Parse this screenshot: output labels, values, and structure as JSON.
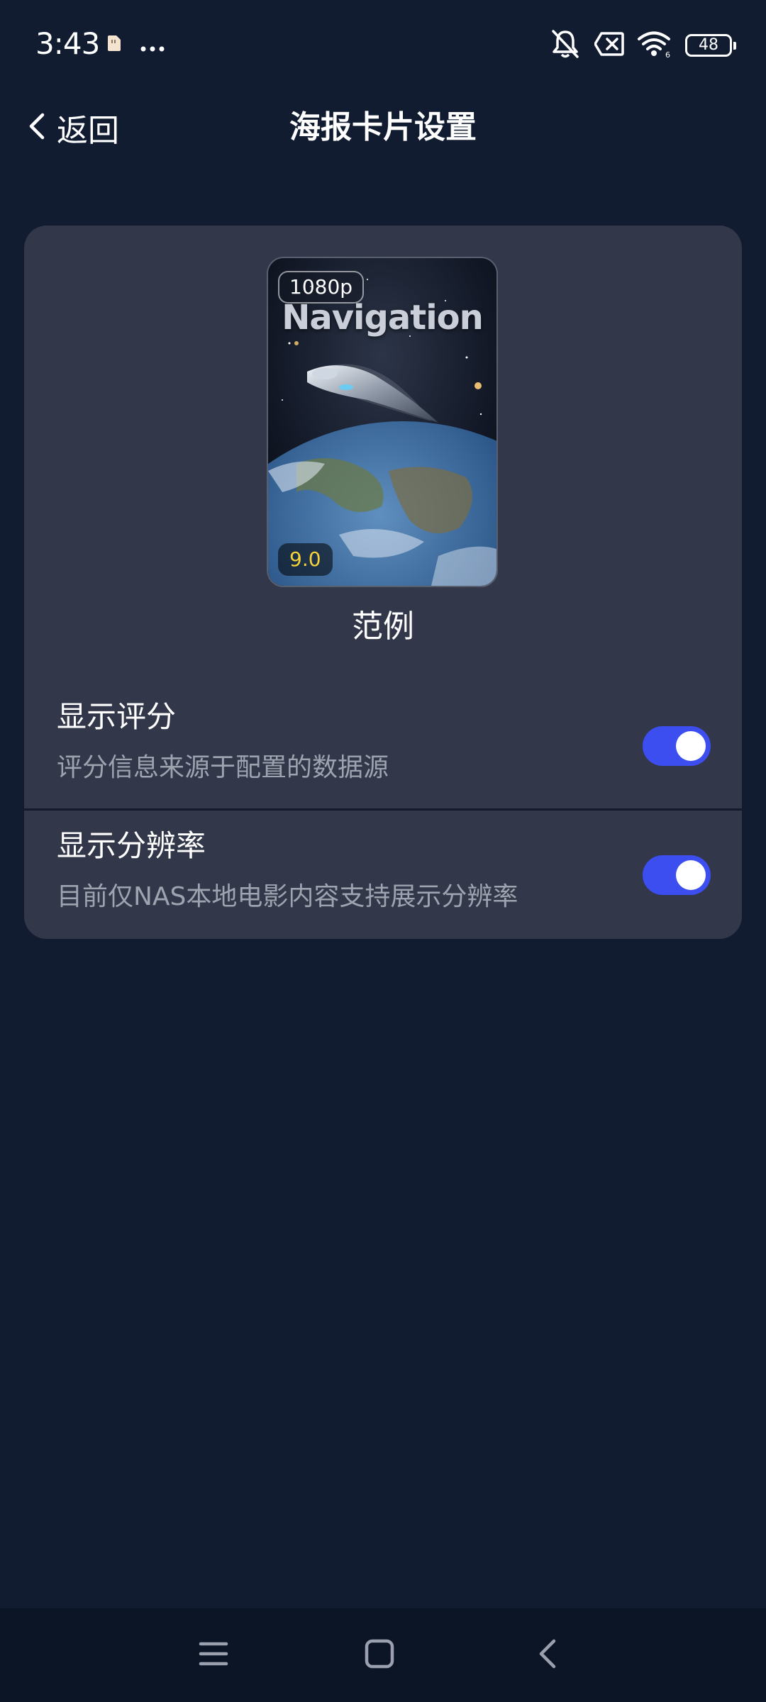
{
  "status_bar": {
    "time": "3:43",
    "icons": [
      "sim-card-icon",
      "more-dots-icon",
      "mute-icon",
      "no-data-icon",
      "wifi-icon",
      "battery-icon"
    ],
    "battery_level": "48"
  },
  "header": {
    "back_label": "返回",
    "title": "海报卡片设置"
  },
  "poster_preview": {
    "resolution_badge": "1080p",
    "movie_title": "Navigation",
    "rating": "9.0",
    "caption": "范例"
  },
  "settings": [
    {
      "title": "显示评分",
      "description": "评分信息来源于配置的数据源",
      "enabled": true
    },
    {
      "title": "显示分辨率",
      "description": "目前仅NAS本地电影内容支持展示分辨率",
      "enabled": true
    }
  ],
  "colors": {
    "background": "#111c31",
    "card": "#323749",
    "toggle_on": "#3c4ef0",
    "rating_text": "#f3d23a"
  },
  "nav_bar": {
    "icons": [
      "menu-icon",
      "home-icon",
      "back-icon"
    ]
  }
}
